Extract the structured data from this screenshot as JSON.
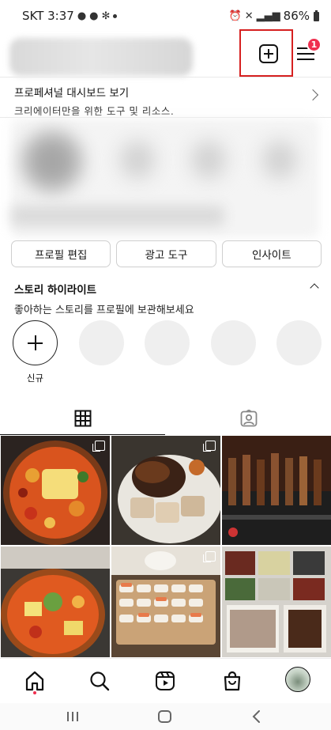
{
  "status_bar": {
    "carrier_time": "SKT 3:37",
    "battery": "86%"
  },
  "header": {
    "menu_badge": "1"
  },
  "pro_dashboard": {
    "title": "프로페셔널 대시보드 보기",
    "subtitle": "크리에이터만을 위한 도구 및 리소스."
  },
  "actions": {
    "edit_profile": "프로필 편집",
    "ad_tools": "광고 도구",
    "insights": "인사이트"
  },
  "story_highlights": {
    "title": "스토리 하이라이트",
    "subtitle": "좋아하는 스토리를 프로필에 보관해보세요",
    "new_label": "신규"
  },
  "colors": {
    "badge": "#ef2f4f",
    "highlight_box": "#d62020"
  }
}
